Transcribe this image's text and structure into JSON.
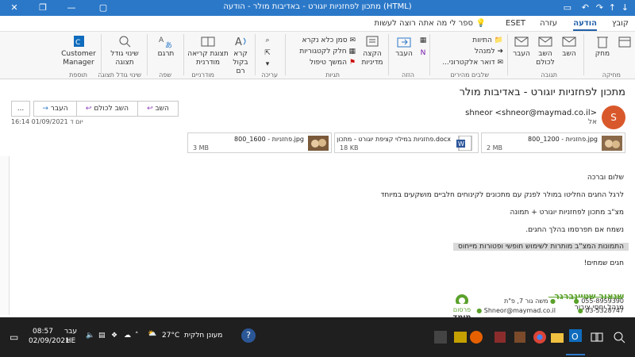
{
  "window": {
    "title": "מתכון לפחזניות יוגורט - באדיבות מולר  -  הודעה (HTML)",
    "min_icon": "minimize-icon",
    "max_icon": "restore-icon",
    "close_icon": "close-icon"
  },
  "tabs": [
    "קובץ",
    "הודעה",
    "עזרה",
    "ESET"
  ],
  "active_tab": "הודעה",
  "tell_me": "ספר לי מה אתה רוצה לעשות",
  "ribbon": {
    "groups": {
      "delete": "מחיקה",
      "respond": "תגובה",
      "quick_steps": "שלבים מהירים",
      "move": "הזזה",
      "tags": "תגיות",
      "editing": "עריכה",
      "speech": "מודרניים",
      "language": "שפה",
      "zoom": "שינוי גודל תצוגה",
      "addin": "תוספת"
    },
    "buttons": {
      "delete": "מחק",
      "archive": "העבר לארכיון",
      "reply": "השב",
      "reply_all": "השב לכולם",
      "forward": "העבר",
      "move": "העבר",
      "policy": "הקצה מדיניות",
      "read_aloud": "קרא בקול רם",
      "immersive": "תצוגת קריאה מודרנית",
      "translate": "תרגם",
      "zoom": "שינוי גודל תצוגה",
      "customer": "Customer Manager"
    },
    "small": {
      "todo": "התיוות",
      "manager": "למנהל",
      "email_team": "דואר אלקטרוני...",
      "mark_unread": "סמן כלא נקרא",
      "categorize": "חלק לקטגוריות",
      "followup": "המשך טיפול"
    }
  },
  "message": {
    "subject": "מתכון לפחזניות יוגורט - באדיבות מולר",
    "from": "shneor <shneor@maymad.co.il>",
    "to": "אל",
    "date": "יום ד 01/09/2021 16:14",
    "avatar_letter": "S",
    "actions": {
      "reply": "השב",
      "reply_all": "השב לכולם",
      "forward": "העבר",
      "more": "..."
    },
    "attachments": [
      {
        "name": "800_1200 - פחזניות.jpg",
        "size": "2 MB"
      },
      {
        "name": "פחזניות במילוי קציפת יוגורט - מתכון.docx",
        "size": "18 KB"
      },
      {
        "name": "800_1600 - פחזניות.jpg",
        "size": "3 MB"
      }
    ],
    "body": [
      "שלום וברכה",
      "לרגל החגים החליטו במולר לפנק עם מתכונים לקינוחים חלביים מושקעים במיוחד",
      "מצ\"ב מתכון לפחזניות יוגורט + תמונה",
      "נשמח אם תפרסמו בהלך החגים.",
      "התמונות המצ\"ב מותרות לשימוש חופשי ופטורות מייחוס",
      "חגים שמחים!"
    ]
  },
  "signature": {
    "name": "שנאור שטיינברגר",
    "role": "מנהל יחסי ציבור",
    "phone1": "055-8959390",
    "phone2": "03-5328747",
    "address": "משה גור 7, פ\"ת",
    "email": "Shneor@maymad.co.il",
    "logo_top": "פרסום",
    "logo_bottom": "מימד"
  },
  "taskbar": {
    "time": "08:57",
    "date": "02/09/2021",
    "lang": "עבר HE",
    "weather_temp": "27°C",
    "weather_text": "מעונן חלקית"
  },
  "colors": {
    "titlebar": "#2b78c8",
    "accent": "#1f5fa8",
    "avatar": "#d9582b",
    "sig_green": "#5aa12b",
    "taskbar": "#1f1f1f"
  }
}
